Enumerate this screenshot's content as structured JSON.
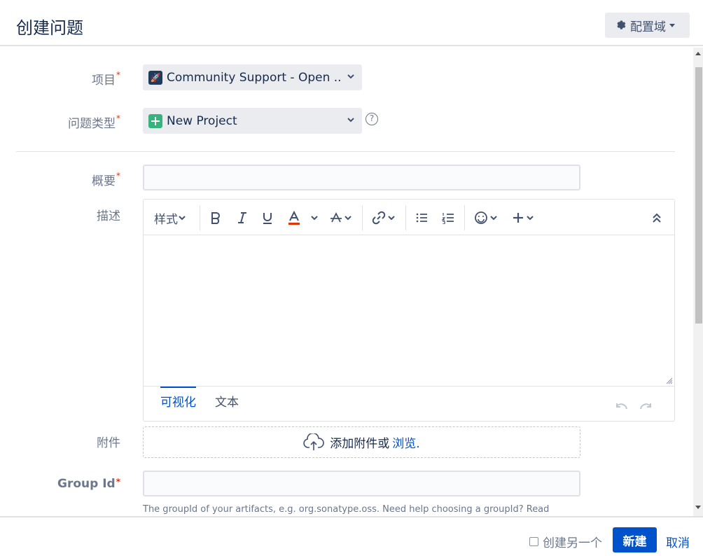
{
  "header": {
    "title": "创建问题",
    "config_label": "配置域"
  },
  "form": {
    "project": {
      "label": "项目",
      "value": "Community Support - Open ..."
    },
    "issue_type": {
      "label": "问题类型",
      "value": "New Project"
    },
    "summary": {
      "label": "概要",
      "value": ""
    },
    "description": {
      "label": "描述",
      "toolbar": {
        "style_label": "样式"
      },
      "tabs": [
        "可视化",
        "文本"
      ]
    },
    "attachment": {
      "label": "附件",
      "drop_text": "添加附件或",
      "browse_link": "浏览."
    },
    "group_id": {
      "label": "Group Id",
      "value": "",
      "hint": "The groupId of your artifacts, e.g. org.sonatype.oss. Need help choosing a groupId? Read"
    }
  },
  "footer": {
    "create_another_label": "创建另一个",
    "create_button": "新建",
    "cancel_link": "取消"
  },
  "colors": {
    "primary": "#0052cc",
    "required": "#de350b",
    "issue_type": "#36b37e"
  }
}
